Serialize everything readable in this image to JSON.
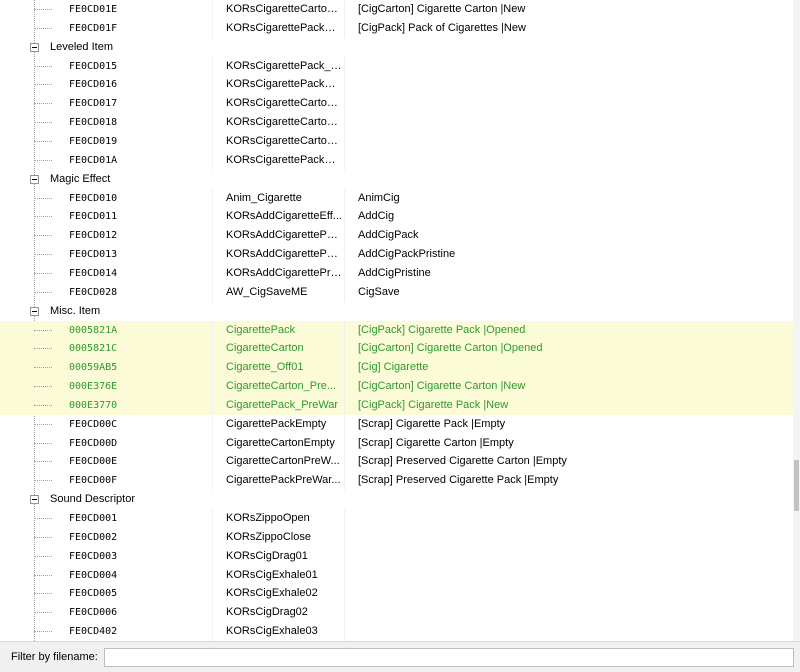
{
  "filter": {
    "label": "Filter by filename:",
    "value": ""
  },
  "scrollbar": {
    "position": 0.78,
    "visible_fraction": 0.08
  },
  "rows": [
    {
      "type": "record",
      "fid": "FE0CD01E",
      "col1": "KORsCigaretteCarton...",
      "col2": "[CigCarton] Cigarette Carton |New",
      "hl": false
    },
    {
      "type": "record",
      "fid": "FE0CD01F",
      "col1": "KORsCigarettePackPr...",
      "col2": "[CigPack] Pack of Cigarettes |New",
      "hl": false
    },
    {
      "type": "group",
      "label": "Leveled Item"
    },
    {
      "type": "record",
      "fid": "FE0CD015",
      "col1": "KORsCigarettePack_LL",
      "col2": "",
      "hl": false
    },
    {
      "type": "record",
      "fid": "FE0CD016",
      "col1": "KORsCigarettePackUse_LL",
      "col2": "",
      "hl": false
    },
    {
      "type": "record",
      "fid": "FE0CD017",
      "col1": "KORsCigaretteCarton_LL",
      "col2": "",
      "hl": false
    },
    {
      "type": "record",
      "fid": "FE0CD018",
      "col1": "KORsCigaretteCartonUse_LL",
      "col2": "",
      "hl": false
    },
    {
      "type": "record",
      "fid": "FE0CD019",
      "col1": "KORsCigaretteCartonNewUse_LL",
      "col2": "",
      "hl": false
    },
    {
      "type": "record",
      "fid": "FE0CD01A",
      "col1": "KORsCigarettePackNewUse_LL",
      "col2": "",
      "hl": false
    },
    {
      "type": "group",
      "label": "Magic Effect"
    },
    {
      "type": "record",
      "fid": "FE0CD010",
      "col1": "Anim_Cigarette",
      "col2": "AnimCig",
      "hl": false
    },
    {
      "type": "record",
      "fid": "FE0CD011",
      "col1": "KORsAddCigaretteEff...",
      "col2": "AddCig",
      "hl": false
    },
    {
      "type": "record",
      "fid": "FE0CD012",
      "col1": "KORsAddCigarettePa...",
      "col2": "AddCigPack",
      "hl": false
    },
    {
      "type": "record",
      "fid": "FE0CD013",
      "col1": "KORsAddCigarettePa...",
      "col2": "AddCigPackPristine",
      "hl": false
    },
    {
      "type": "record",
      "fid": "FE0CD014",
      "col1": "KORsAddCigarettePri...",
      "col2": "AddCigPristine",
      "hl": false
    },
    {
      "type": "record",
      "fid": "FE0CD028",
      "col1": "AW_CigSaveME",
      "col2": "CigSave",
      "hl": false
    },
    {
      "type": "group",
      "label": "Misc. Item"
    },
    {
      "type": "record",
      "fid": "0005821A",
      "col1": "CigarettePack",
      "col2": "[CigPack] Cigarette Pack |Opened",
      "hl": true
    },
    {
      "type": "record",
      "fid": "0005821C",
      "col1": "CigaretteCarton",
      "col2": "[CigCarton] Cigarette Carton |Opened",
      "hl": true
    },
    {
      "type": "record",
      "fid": "00059AB5",
      "col1": "Cigarette_Off01",
      "col2": "[Cig] Cigarette",
      "hl": true
    },
    {
      "type": "record",
      "fid": "000E376E",
      "col1": "CigaretteCarton_Pre...",
      "col2": "[CigCarton] Cigarette Carton |New",
      "hl": true
    },
    {
      "type": "record",
      "fid": "000E3770",
      "col1": "CigarettePack_PreWar",
      "col2": "[CigPack] Cigarette Pack |New",
      "hl": true
    },
    {
      "type": "record",
      "fid": "FE0CD00C",
      "col1": "CigarettePackEmpty",
      "col2": "[Scrap] Cigarette Pack |Empty",
      "hl": false
    },
    {
      "type": "record",
      "fid": "FE0CD00D",
      "col1": "CigaretteCartonEmpty",
      "col2": "[Scrap] Cigarette Carton |Empty",
      "hl": false
    },
    {
      "type": "record",
      "fid": "FE0CD00E",
      "col1": "CigaretteCartonPreW...",
      "col2": "[Scrap] Preserved Cigarette Carton |Empty",
      "hl": false
    },
    {
      "type": "record",
      "fid": "FE0CD00F",
      "col1": "CigarettePackPreWar...",
      "col2": "[Scrap] Preserved Cigarette Pack |Empty",
      "hl": false
    },
    {
      "type": "group",
      "label": "Sound Descriptor"
    },
    {
      "type": "record",
      "fid": "FE0CD001",
      "col1": "KORsZippoOpen",
      "col2": "",
      "hl": false
    },
    {
      "type": "record",
      "fid": "FE0CD002",
      "col1": "KORsZippoClose",
      "col2": "",
      "hl": false
    },
    {
      "type": "record",
      "fid": "FE0CD003",
      "col1": "KORsCigDrag01",
      "col2": "",
      "hl": false
    },
    {
      "type": "record",
      "fid": "FE0CD004",
      "col1": "KORsCigExhale01",
      "col2": "",
      "hl": false
    },
    {
      "type": "record",
      "fid": "FE0CD005",
      "col1": "KORsCigExhale02",
      "col2": "",
      "hl": false
    },
    {
      "type": "record",
      "fid": "FE0CD006",
      "col1": "KORsCigDrag02",
      "col2": "",
      "hl": false
    },
    {
      "type": "record",
      "fid": "FE0CD402",
      "col1": "KORsCigExhale03",
      "col2": "",
      "hl": false
    }
  ]
}
